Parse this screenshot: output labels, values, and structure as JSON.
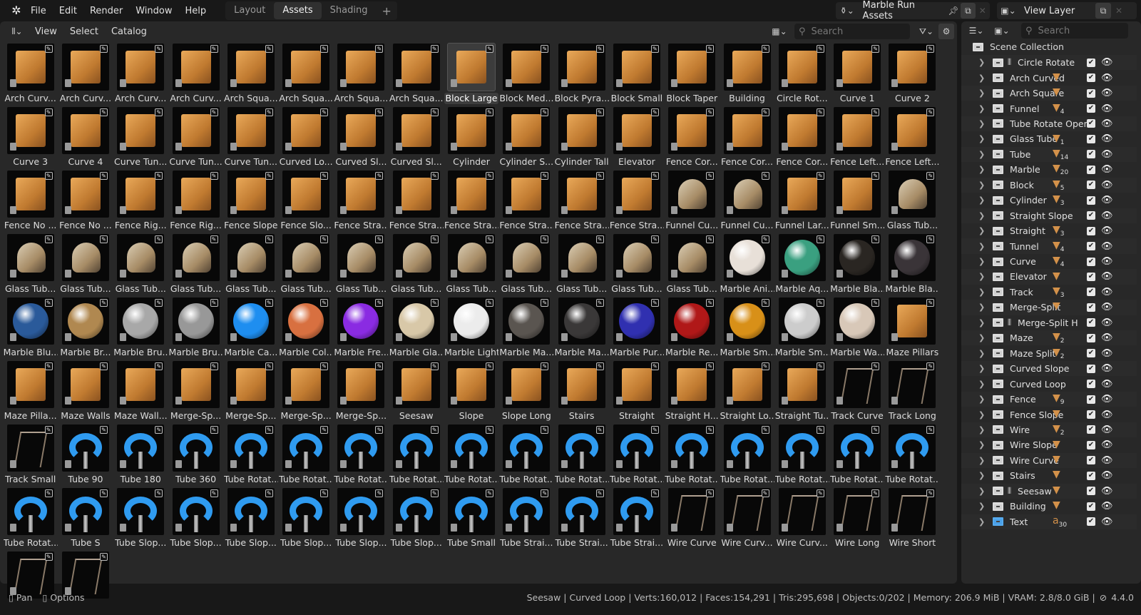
{
  "topbar": {
    "menus": [
      "File",
      "Edit",
      "Render",
      "Window",
      "Help"
    ],
    "workspaces": [
      "Layout",
      "Assets",
      "Shading"
    ],
    "active_workspace": "Assets",
    "scene": "Marble Run Assets",
    "view_layer": "View Layer"
  },
  "asset_browser": {
    "menus": [
      "View",
      "Select",
      "Catalog"
    ],
    "search_placeholder": "Search",
    "items": [
      {
        "label": "Arch Curv...",
        "kind": "wood"
      },
      {
        "label": "Arch Curv...",
        "kind": "wood"
      },
      {
        "label": "Arch Curv...",
        "kind": "wood"
      },
      {
        "label": "Arch Curv...",
        "kind": "wood"
      },
      {
        "label": "Arch Squa...",
        "kind": "wood"
      },
      {
        "label": "Arch Squa...",
        "kind": "wood"
      },
      {
        "label": "Arch Squa...",
        "kind": "wood"
      },
      {
        "label": "Arch Squa...",
        "kind": "wood"
      },
      {
        "label": "Block Large",
        "kind": "wood",
        "selected": true
      },
      {
        "label": "Block Med...",
        "kind": "wood"
      },
      {
        "label": "Block Pyra...",
        "kind": "wood"
      },
      {
        "label": "Block Small",
        "kind": "wood"
      },
      {
        "label": "Block Taper",
        "kind": "wood"
      },
      {
        "label": "Building",
        "kind": "wood"
      },
      {
        "label": "Circle Rot...",
        "kind": "wood"
      },
      {
        "label": "Curve 1",
        "kind": "wood"
      },
      {
        "label": "Curve 2",
        "kind": "wood"
      },
      {
        "label": "Curve 3",
        "kind": "wood"
      },
      {
        "label": "Curve 4",
        "kind": "wood"
      },
      {
        "label": "Curve Tun...",
        "kind": "wood"
      },
      {
        "label": "Curve Tun...",
        "kind": "wood"
      },
      {
        "label": "Curve Tun...",
        "kind": "wood"
      },
      {
        "label": "Curved Lo...",
        "kind": "wood"
      },
      {
        "label": "Curved Sl...",
        "kind": "wood"
      },
      {
        "label": "Curved Sl...",
        "kind": "wood"
      },
      {
        "label": "Cylinder",
        "kind": "wood"
      },
      {
        "label": "Cylinder S...",
        "kind": "wood"
      },
      {
        "label": "Cylinder Tall",
        "kind": "wood"
      },
      {
        "label": "Elevator",
        "kind": "wood"
      },
      {
        "label": "Fence Cor...",
        "kind": "wood"
      },
      {
        "label": "Fence Cor...",
        "kind": "wood"
      },
      {
        "label": "Fence Cor...",
        "kind": "wood"
      },
      {
        "label": "Fence Left...",
        "kind": "wood"
      },
      {
        "label": "Fence Left...",
        "kind": "wood"
      },
      {
        "label": "Fence No ...",
        "kind": "wood"
      },
      {
        "label": "Fence No ...",
        "kind": "wood"
      },
      {
        "label": "Fence Rig...",
        "kind": "wood"
      },
      {
        "label": "Fence Rig...",
        "kind": "wood"
      },
      {
        "label": "Fence Slope",
        "kind": "wood"
      },
      {
        "label": "Fence Slo...",
        "kind": "wood"
      },
      {
        "label": "Fence Stra...",
        "kind": "wood"
      },
      {
        "label": "Fence Stra...",
        "kind": "wood"
      },
      {
        "label": "Fence Stra...",
        "kind": "wood"
      },
      {
        "label": "Fence Stra...",
        "kind": "wood"
      },
      {
        "label": "Fence Stra...",
        "kind": "wood"
      },
      {
        "label": "Fence Stra...",
        "kind": "wood"
      },
      {
        "label": "Funnel Cu...",
        "kind": "glass"
      },
      {
        "label": "Funnel Cu...",
        "kind": "glass"
      },
      {
        "label": "Funnel Lar...",
        "kind": "wood"
      },
      {
        "label": "Funnel Sm...",
        "kind": "wood"
      },
      {
        "label": "Glass Tub...",
        "kind": "glass"
      },
      {
        "label": "Glass Tub...",
        "kind": "glass"
      },
      {
        "label": "Glass Tub...",
        "kind": "glass"
      },
      {
        "label": "Glass Tub...",
        "kind": "glass"
      },
      {
        "label": "Glass Tub...",
        "kind": "glass"
      },
      {
        "label": "Glass Tub...",
        "kind": "glass"
      },
      {
        "label": "Glass Tub...",
        "kind": "glass"
      },
      {
        "label": "Glass Tub...",
        "kind": "glass"
      },
      {
        "label": "Glass Tub...",
        "kind": "glass"
      },
      {
        "label": "Glass Tub...",
        "kind": "glass"
      },
      {
        "label": "Glass Tub...",
        "kind": "glass"
      },
      {
        "label": "Glass Tub...",
        "kind": "glass"
      },
      {
        "label": "Glass Tub...",
        "kind": "glass"
      },
      {
        "label": "Glass Tub...",
        "kind": "glass"
      },
      {
        "label": "Marble Ani...",
        "kind": "marble",
        "color": "#e8e0d8"
      },
      {
        "label": "Marble Aq...",
        "kind": "marble",
        "color": "#3aa080"
      },
      {
        "label": "Marble Bla...",
        "kind": "marble",
        "color": "#2a2622"
      },
      {
        "label": "Marble Bla...",
        "kind": "marble",
        "color": "#3a3438"
      },
      {
        "label": "Marble Blu...",
        "kind": "marble",
        "color": "#2a5a9a"
      },
      {
        "label": "Marble Br...",
        "kind": "marble",
        "color": "#b08850"
      },
      {
        "label": "Marble Bru...",
        "kind": "marble",
        "color": "#a8a8a8"
      },
      {
        "label": "Marble Bru...",
        "kind": "marble",
        "color": "#989898"
      },
      {
        "label": "Marble Ca...",
        "kind": "marble",
        "color": "#1e8ef0"
      },
      {
        "label": "Marble Col...",
        "kind": "marble",
        "color": "#d87040"
      },
      {
        "label": "Marble Fre...",
        "kind": "marble",
        "color": "#8a2be2"
      },
      {
        "label": "Marble Gla...",
        "kind": "marble",
        "color": "#d8c8a8"
      },
      {
        "label": "Marble Light",
        "kind": "marble",
        "color": "#ececec"
      },
      {
        "label": "Marble Ma...",
        "kind": "marble",
        "color": "#5a5550"
      },
      {
        "label": "Marble Ma...",
        "kind": "marble",
        "color": "#3a3838"
      },
      {
        "label": "Marble Pur...",
        "kind": "marble",
        "color": "#3030b0"
      },
      {
        "label": "Marble Re...",
        "kind": "marble",
        "color": "#b01818"
      },
      {
        "label": "Marble Sm...",
        "kind": "marble",
        "color": "#d89018"
      },
      {
        "label": "Marble Sm...",
        "kind": "marble",
        "color": "#cccccc"
      },
      {
        "label": "Marble Wa...",
        "kind": "marble",
        "color": "#d8c8b8"
      },
      {
        "label": "Maze Pillars",
        "kind": "wood"
      },
      {
        "label": "Maze Pilla...",
        "kind": "wood"
      },
      {
        "label": "Maze Walls",
        "kind": "wood"
      },
      {
        "label": "Maze Wall...",
        "kind": "wood"
      },
      {
        "label": "Merge-Sp...",
        "kind": "wood"
      },
      {
        "label": "Merge-Sp...",
        "kind": "wood"
      },
      {
        "label": "Merge-Sp...",
        "kind": "wood"
      },
      {
        "label": "Merge-Sp...",
        "kind": "wood"
      },
      {
        "label": "Seesaw",
        "kind": "wood"
      },
      {
        "label": "Slope",
        "kind": "wood"
      },
      {
        "label": "Slope Long",
        "kind": "wood"
      },
      {
        "label": "Stairs",
        "kind": "wood"
      },
      {
        "label": "Straight",
        "kind": "wood"
      },
      {
        "label": "Straight H...",
        "kind": "wood"
      },
      {
        "label": "Straight Lo...",
        "kind": "wood"
      },
      {
        "label": "Straight Tu...",
        "kind": "wood"
      },
      {
        "label": "Track Curve",
        "kind": "wire"
      },
      {
        "label": "Track Long",
        "kind": "wire"
      },
      {
        "label": "Track Small",
        "kind": "wire"
      },
      {
        "label": "Tube 90",
        "kind": "tube"
      },
      {
        "label": "Tube 180",
        "kind": "tube"
      },
      {
        "label": "Tube 360",
        "kind": "tube"
      },
      {
        "label": "Tube Rotat...",
        "kind": "tube"
      },
      {
        "label": "Tube Rotat...",
        "kind": "tube"
      },
      {
        "label": "Tube Rotat...",
        "kind": "tube"
      },
      {
        "label": "Tube Rotat...",
        "kind": "tube"
      },
      {
        "label": "Tube Rotat...",
        "kind": "tube"
      },
      {
        "label": "Tube Rotat...",
        "kind": "tube"
      },
      {
        "label": "Tube Rotat...",
        "kind": "tube"
      },
      {
        "label": "Tube Rotat...",
        "kind": "tube"
      },
      {
        "label": "Tube Rotat...",
        "kind": "tube"
      },
      {
        "label": "Tube Rotat...",
        "kind": "tube"
      },
      {
        "label": "Tube Rotat...",
        "kind": "tube"
      },
      {
        "label": "Tube Rotat...",
        "kind": "tube"
      },
      {
        "label": "Tube Rotat...",
        "kind": "tube"
      },
      {
        "label": "Tube Rotat...",
        "kind": "tube"
      },
      {
        "label": "Tube S",
        "kind": "tube"
      },
      {
        "label": "Tube Slop...",
        "kind": "tube"
      },
      {
        "label": "Tube Slop...",
        "kind": "tube"
      },
      {
        "label": "Tube Slop...",
        "kind": "tube"
      },
      {
        "label": "Tube Slop...",
        "kind": "tube"
      },
      {
        "label": "Tube Slop...",
        "kind": "tube"
      },
      {
        "label": "Tube Slop...",
        "kind": "tube"
      },
      {
        "label": "Tube Small",
        "kind": "tube"
      },
      {
        "label": "Tube Strai...",
        "kind": "tube"
      },
      {
        "label": "Tube Strai...",
        "kind": "tube"
      },
      {
        "label": "Tube Strai...",
        "kind": "tube"
      },
      {
        "label": "Wire Curve",
        "kind": "wire"
      },
      {
        "label": "Wire Curv...",
        "kind": "wire"
      },
      {
        "label": "Wire Curv...",
        "kind": "wire"
      },
      {
        "label": "Wire Long",
        "kind": "wire"
      },
      {
        "label": "Wire Short",
        "kind": "wire"
      },
      {
        "label": "",
        "kind": "wire"
      },
      {
        "label": "",
        "kind": "wire"
      }
    ]
  },
  "outliner": {
    "search_placeholder": "Search",
    "root": "Scene Collection",
    "items": [
      {
        "name": "Circle Rotate",
        "asset": true,
        "count": null
      },
      {
        "name": "Arch Curved",
        "count": ""
      },
      {
        "name": "Arch Square",
        "count": ""
      },
      {
        "name": "Funnel",
        "count": "4"
      },
      {
        "name": "Tube Rotate Open",
        "count": null
      },
      {
        "name": "Glass Tube",
        "count": "1"
      },
      {
        "name": "Tube",
        "count": "14"
      },
      {
        "name": "Marble",
        "count": "20"
      },
      {
        "name": "Block",
        "count": "5"
      },
      {
        "name": "Cylinder",
        "count": "3"
      },
      {
        "name": "Straight Slope",
        "count": null
      },
      {
        "name": "Straight",
        "count": "3"
      },
      {
        "name": "Tunnel",
        "count": "4"
      },
      {
        "name": "Curve",
        "count": "4"
      },
      {
        "name": "Elevator",
        "count": ""
      },
      {
        "name": "Track",
        "count": "3"
      },
      {
        "name": "Merge-Split",
        "count": ""
      },
      {
        "name": "Merge-Split H",
        "asset": true,
        "count": null
      },
      {
        "name": "Maze",
        "count": "2"
      },
      {
        "name": "Maze Split",
        "count": "2"
      },
      {
        "name": "Curved Slope",
        "count": null
      },
      {
        "name": "Curved Loop",
        "count": null
      },
      {
        "name": "Fence",
        "count": "9"
      },
      {
        "name": "Fence Slope",
        "count": ""
      },
      {
        "name": "Wire",
        "count": "2"
      },
      {
        "name": "Wire Slope",
        "count": ""
      },
      {
        "name": "Wire Curve",
        "count": ""
      },
      {
        "name": "Stairs",
        "count": ""
      },
      {
        "name": "Seesaw",
        "asset": true,
        "count": ""
      },
      {
        "name": "Building",
        "count": ""
      },
      {
        "name": "Text",
        "count": "30",
        "text": true
      }
    ]
  },
  "status": {
    "left": [
      "Pan",
      "Options"
    ],
    "stats": "Seesaw | Curved Loop | Verts:160,012 | Faces:154,291 | Tris:295,698 | Objects:0/202 | Memory: 206.9 MiB | VRAM: 2.8/8.0 GiB |",
    "version": "4.4.0"
  }
}
